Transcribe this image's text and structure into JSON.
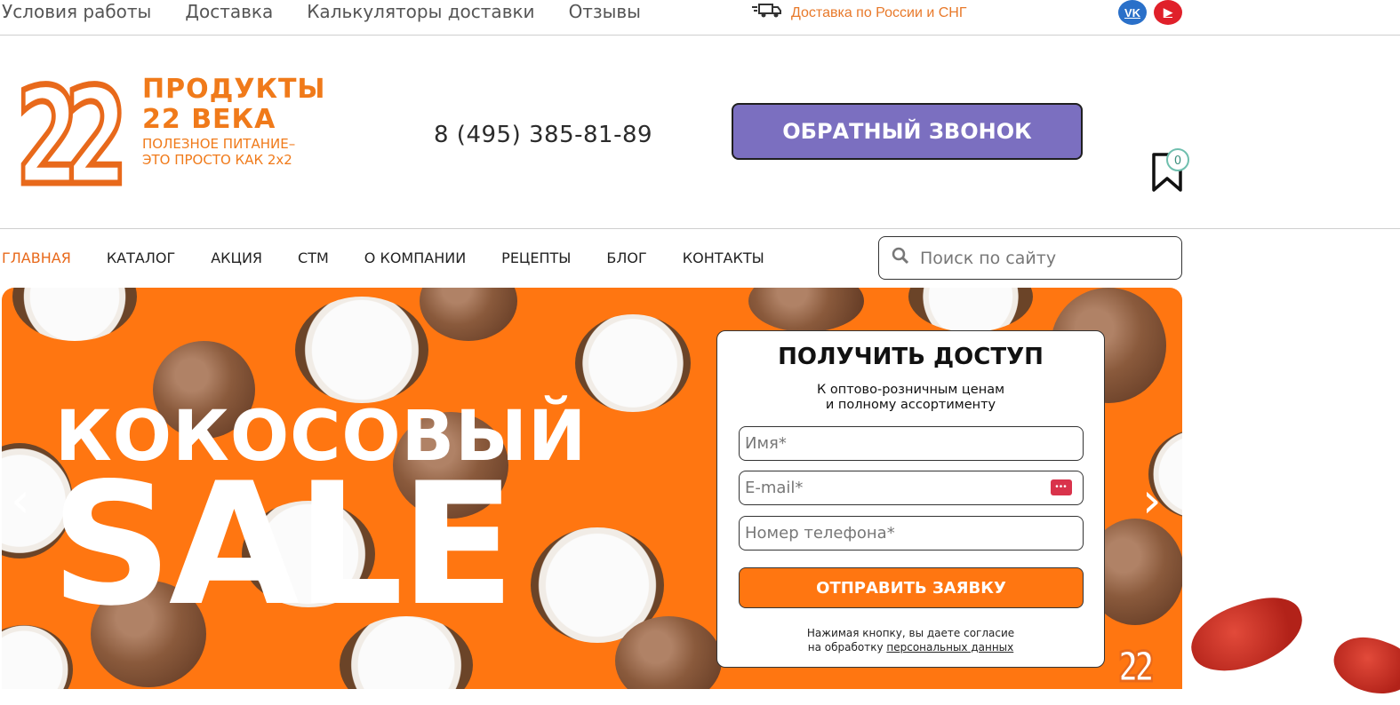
{
  "top_nav": {
    "links": [
      "Условия работы",
      "Доставка",
      "Калькуляторы доставки",
      "Отзывы"
    ],
    "delivery_text": "Доставка по России и СНГ"
  },
  "social": {
    "vk": "VK",
    "youtube": "▶"
  },
  "header": {
    "logo_number": "22",
    "logo_title_1": "ПРОДУКТЫ",
    "logo_title_2": "22 ВЕКА",
    "logo_sub_1": "ПОЛЕЗНОЕ ПИТАНИЕ–",
    "logo_sub_2": "ЭТО ПРОСТО КАК 2x2",
    "phone": "8 (495) 385-81-89",
    "callback_label": "ОБРАТНЫЙ ЗВОНОК",
    "favorites_count": "0"
  },
  "main_nav": {
    "items": [
      "ГЛАВНАЯ",
      "КАТАЛОГ",
      "АКЦИЯ",
      "СТМ",
      "О КОМПАНИИ",
      "РЕЦЕПТЫ",
      "БЛОГ",
      "КОНТАКТЫ"
    ],
    "active": "ГЛАВНАЯ"
  },
  "search": {
    "placeholder": "Поиск по сайту"
  },
  "banner": {
    "line1": "КОКОСОВЫЙ",
    "line2": "SALE",
    "prev_arrow": "‹",
    "next_arrow": "›",
    "corner_logo": "22"
  },
  "form": {
    "title": "ПОЛУЧИТЬ ДОСТУП",
    "subtitle_1": "К оптово-розничным ценам",
    "subtitle_2": "и полному ассортименту",
    "name_placeholder": "Имя*",
    "email_placeholder": "E-mail*",
    "phone_placeholder": "Номер телефона*",
    "submit_label": "ОТПРАВИТЬ ЗАЯВКУ",
    "consent_1": "Нажимая кнопку, вы даете согласие",
    "consent_2_prefix": "на обработку",
    "consent_link": "персональных данных"
  },
  "colors": {
    "brand_orange": "#ff7611",
    "callback_purple": "#7b6fc0",
    "logo_orange": "#e8691b"
  }
}
